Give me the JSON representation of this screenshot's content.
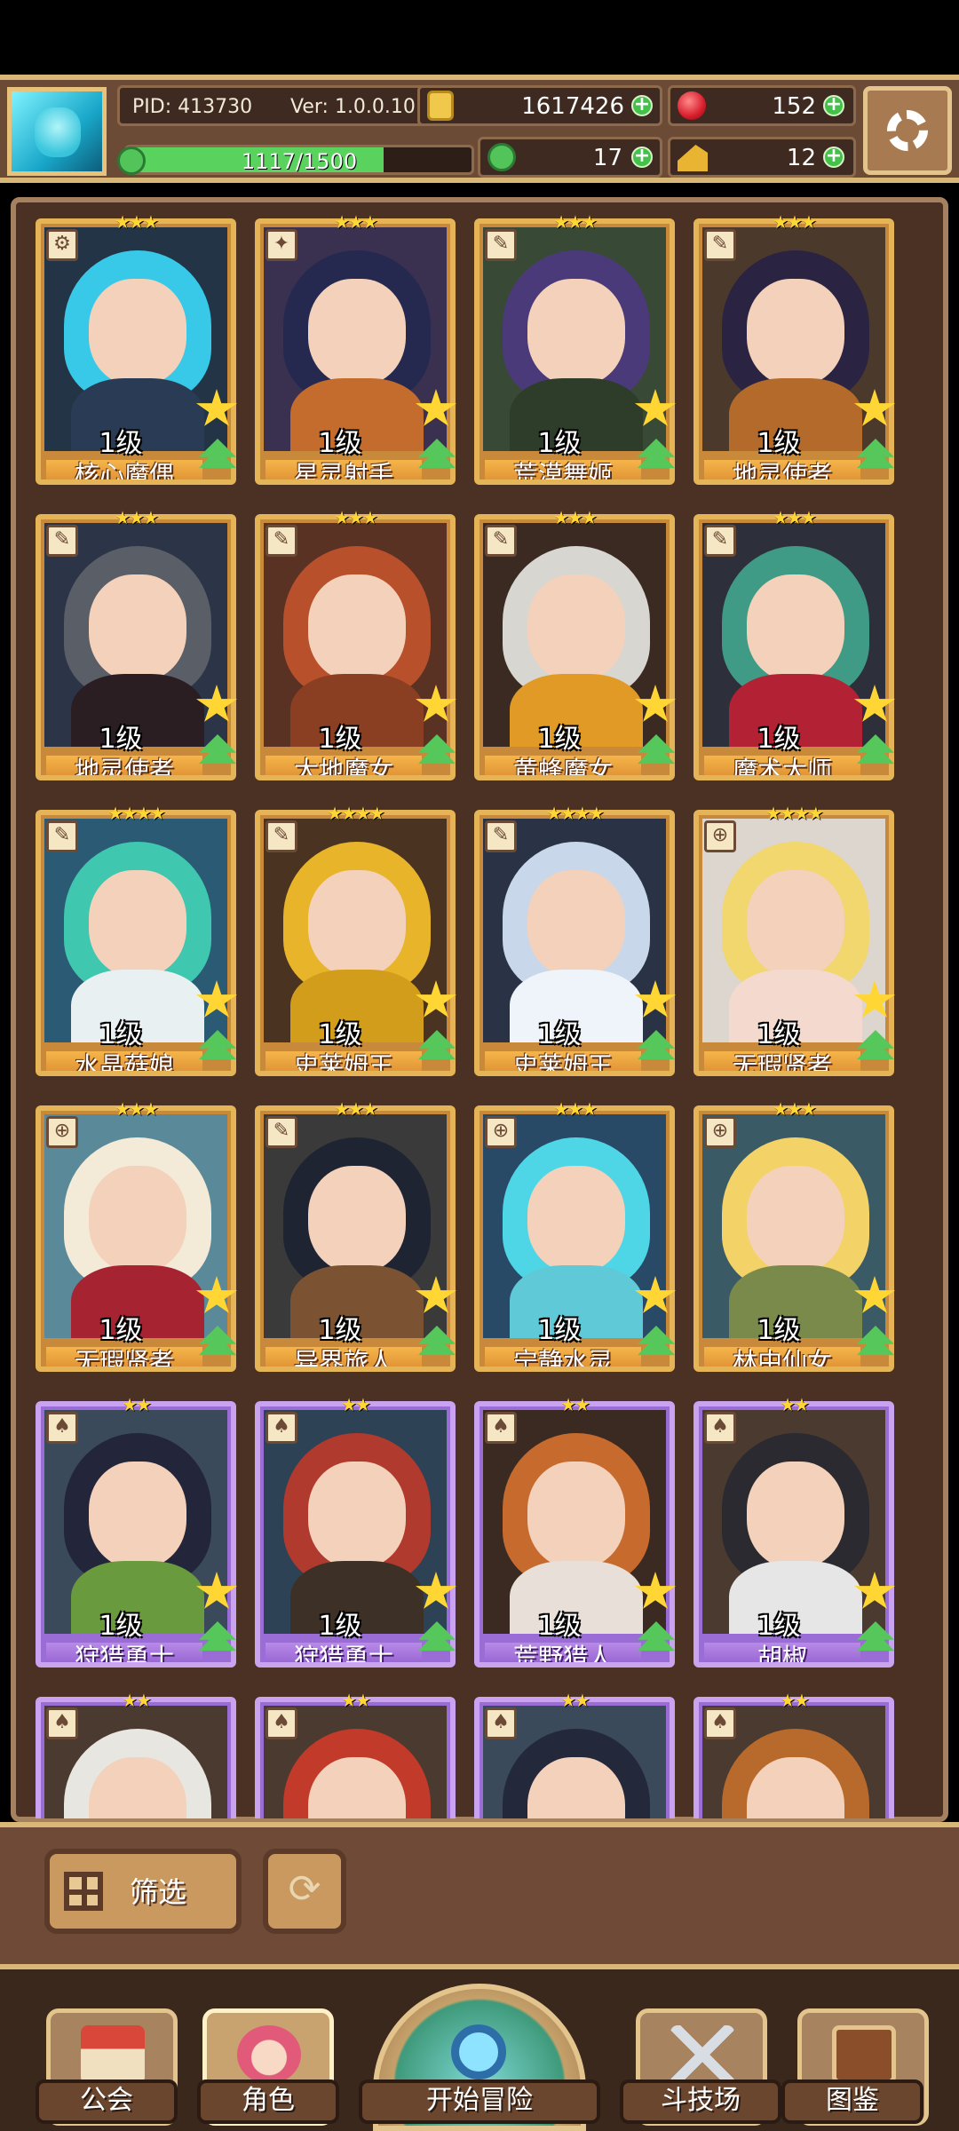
{
  "header": {
    "pid": "PID: 413730",
    "version": "Ver: 1.0.0.10",
    "gold": "1617426",
    "gems": "152",
    "clovers": "17",
    "cheese": "12",
    "xp_text": "1117/1500",
    "xp_progress": 0.745,
    "icons": {
      "avatar": "player-avatar-icon",
      "gold": "gold-coin-icon",
      "gems": "red-gem-icon",
      "clovers": "clover-icon",
      "cheese": "cheese-icon",
      "settings": "gear-icon"
    }
  },
  "cards": [
    {
      "name": "核心魔偶",
      "level": "1级",
      "stars": "★★★",
      "type_icon": "staff-icon",
      "rarity": "gold",
      "hair": "#38c9e8",
      "body": "#2a3b55",
      "bg": "#223446"
    },
    {
      "name": "星灵射手",
      "level": "1级",
      "stars": "★★★",
      "type_icon": "bow-icon",
      "rarity": "gold",
      "hair": "#25284f",
      "body": "#c46b2e",
      "bg": "#3a3050"
    },
    {
      "name": "荒漠舞姬",
      "level": "1级",
      "stars": "★★★",
      "type_icon": "scepter-icon",
      "rarity": "gold",
      "hair": "#4a3a7a",
      "body": "#2e3d2a",
      "bg": "#384a36"
    },
    {
      "name": "地灵使者",
      "level": "1级",
      "stars": "★★★",
      "type_icon": "scepter-icon",
      "rarity": "gold",
      "hair": "#2b2342",
      "body": "#b36a2a",
      "bg": "#4b3a2c"
    },
    {
      "name": "地灵使者",
      "level": "1级",
      "stars": "★★★",
      "type_icon": "scepter-icon",
      "rarity": "gold",
      "hair": "#5a5e66",
      "body": "#2a1e22",
      "bg": "#2c3448"
    },
    {
      "name": "大地魔女",
      "level": "1级",
      "stars": "★★★",
      "type_icon": "scepter-icon",
      "rarity": "gold",
      "hair": "#b8502c",
      "body": "#8a3f22",
      "bg": "#5a3224"
    },
    {
      "name": "黄蜂魔女",
      "level": "1级",
      "stars": "★★★",
      "type_icon": "scepter-icon",
      "rarity": "gold",
      "hair": "#d8d6d0",
      "body": "#e09a25",
      "bg": "#3b2a22"
    },
    {
      "name": "魔术大师",
      "level": "1级",
      "stars": "★★★",
      "type_icon": "scepter-icon",
      "rarity": "gold",
      "hair": "#3f9b86",
      "body": "#b22234",
      "bg": "#2d2f3a"
    },
    {
      "name": "水晶菇娘",
      "level": "1级",
      "stars": "★★★★",
      "type_icon": "scepter-icon",
      "rarity": "gold",
      "hair": "#3fc7b0",
      "body": "#e8f0f2",
      "bg": "#2a5a74"
    },
    {
      "name": "史莱姆王",
      "level": "1级",
      "stars": "★★★★",
      "type_icon": "scepter-icon",
      "rarity": "gold",
      "hair": "#e7b42a",
      "body": "#d39d1c",
      "bg": "#4a3320"
    },
    {
      "name": "史莱姆王",
      "level": "1级",
      "stars": "★★★★",
      "type_icon": "scepter-icon",
      "rarity": "gold",
      "hair": "#c8d8ea",
      "body": "#eef4fa",
      "bg": "#2a3346"
    },
    {
      "name": "无瑕贤者",
      "level": "1级",
      "stars": "★★★★",
      "type_icon": "shield-icon",
      "rarity": "gold",
      "hair": "#f2d66e",
      "body": "#f4d9cf",
      "bg": "#ddd6cf"
    },
    {
      "name": "无瑕贤者",
      "level": "1级",
      "stars": "★★★",
      "type_icon": "shield-icon",
      "rarity": "gold",
      "hair": "#f3ebd8",
      "body": "#a62432",
      "bg": "#5a8a9a"
    },
    {
      "name": "异界旅人",
      "level": "1级",
      "stars": "★★★",
      "type_icon": "scepter-icon",
      "rarity": "gold",
      "hair": "#1f2433",
      "body": "#7b5232",
      "bg": "#3a3a3a"
    },
    {
      "name": "宁静水灵",
      "level": "1级",
      "stars": "★★★",
      "type_icon": "shield-icon",
      "rarity": "gold",
      "hair": "#4fd6e6",
      "body": "#5fc9d8",
      "bg": "#284a66"
    },
    {
      "name": "林中仙女",
      "level": "1级",
      "stars": "★★★",
      "type_icon": "shield-icon",
      "rarity": "gold",
      "hair": "#f3d267",
      "body": "#7a8a4a",
      "bg": "#3a5a66"
    },
    {
      "name": "狩猎勇士",
      "level": "1级",
      "stars": "★★",
      "type_icon": "axe-icon",
      "rarity": "purple",
      "hair": "#23253a",
      "body": "#6a9a3e",
      "bg": "#3a4a5a"
    },
    {
      "name": "狩猎勇士",
      "level": "1级",
      "stars": "★★",
      "type_icon": "axe-icon",
      "rarity": "purple",
      "hair": "#b03a2e",
      "body": "#3d3026",
      "bg": "#2d4254"
    },
    {
      "name": "荒野猎人",
      "level": "1级",
      "stars": "★★",
      "type_icon": "axe-icon",
      "rarity": "purple",
      "hair": "#c76a2e",
      "body": "#e8e0d8",
      "bg": "#3a2a22"
    },
    {
      "name": "胡椒",
      "level": "1级",
      "stars": "★★",
      "type_icon": "axe-icon",
      "rarity": "purple",
      "hair": "#2a2a30",
      "body": "#e6e6e6",
      "bg": "#4a3a30"
    },
    {
      "name": "",
      "level": "",
      "stars": "★★",
      "type_icon": "axe-icon",
      "rarity": "purple",
      "hair": "#e8e6e0",
      "body": "#3a3a40",
      "bg": "#4a3a30"
    },
    {
      "name": "",
      "level": "",
      "stars": "★★",
      "type_icon": "axe-icon",
      "rarity": "purple",
      "hair": "#c23a2a",
      "body": "#8a3a2a",
      "bg": "#4a3a30"
    },
    {
      "name": "",
      "level": "",
      "stars": "★★",
      "type_icon": "axe-icon",
      "rarity": "purple",
      "hair": "#23283a",
      "body": "#3a3a40",
      "bg": "#3a4a5a"
    },
    {
      "name": "",
      "level": "",
      "stars": "★★",
      "type_icon": "axe-icon",
      "rarity": "purple",
      "hair": "#b8692c",
      "body": "#6a3a22",
      "bg": "#4a3a30"
    }
  ],
  "controls": {
    "filter_label": "筛选",
    "filter_icon": "grid-icon",
    "refresh_icon": "refresh-icon"
  },
  "nav": {
    "guild": "公会",
    "character": "角色",
    "adventure": "开始冒险",
    "arena": "斗技场",
    "codex": "图鉴",
    "icons": {
      "guild": "guild-house-icon",
      "character": "character-icon",
      "adventure": "magnifier-icon",
      "arena": "crossed-swords-icon",
      "codex": "book-icon"
    }
  }
}
